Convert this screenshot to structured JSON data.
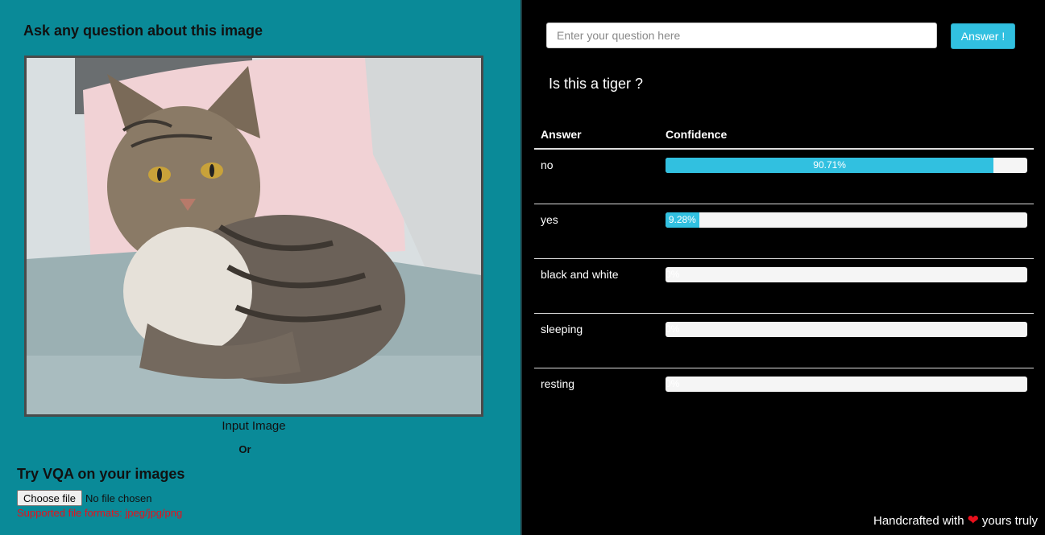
{
  "left": {
    "title": "Ask any question about this image",
    "image_caption": "Input Image",
    "or_label": "Or",
    "try_title": "Try VQA on your images",
    "file_button": "Choose file",
    "file_status": "No file chosen",
    "formats_note": "Supported file formats: jpeg/jpg/png"
  },
  "right": {
    "question_placeholder": "Enter your question here",
    "answer_button": "Answer !",
    "question_text": "Is this a tiger ?",
    "table": {
      "headers": [
        "Answer",
        "Confidence"
      ],
      "rows": [
        {
          "answer": "no",
          "confidence": 90.71,
          "label": "90.71%"
        },
        {
          "answer": "yes",
          "confidence": 9.28,
          "label": "9.28%"
        },
        {
          "answer": "black and white",
          "confidence": 0,
          "label": "0%"
        },
        {
          "answer": "sleeping",
          "confidence": 0,
          "label": "0%"
        },
        {
          "answer": "resting",
          "confidence": 0,
          "label": "0%"
        }
      ]
    },
    "footer_prefix": "Handcrafted with",
    "footer_suffix": "yours truly",
    "footer_icon": "heart-icon"
  },
  "colors": {
    "left_bg": "#0a8a98",
    "accent": "#31c0e0",
    "heart": "#e8101c"
  }
}
